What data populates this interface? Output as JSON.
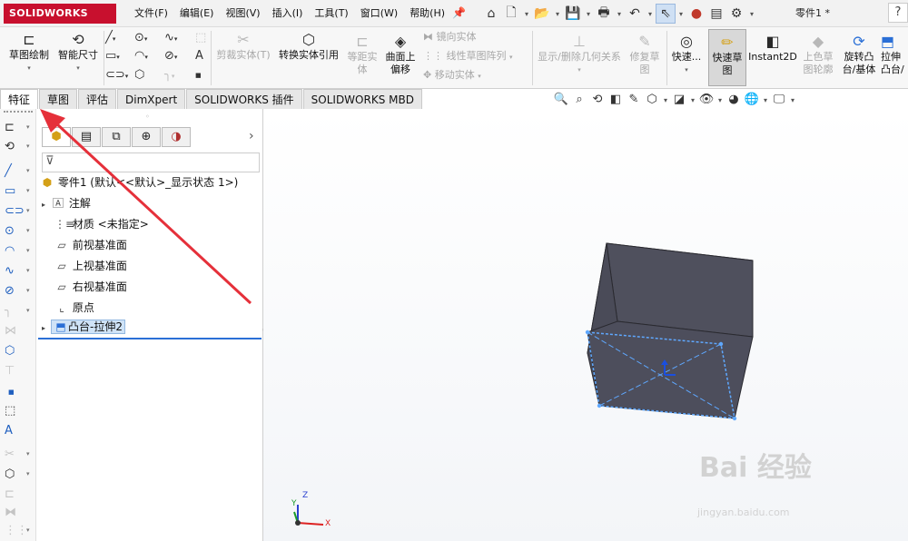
{
  "app": {
    "logo": "SOLIDWORKS",
    "doc_title": "零件1 *"
  },
  "menu": [
    "文件(F)",
    "编辑(E)",
    "视图(V)",
    "插入(I)",
    "工具(T)",
    "窗口(W)",
    "帮助(H)"
  ],
  "quick_access": [
    "home-icon",
    "new-doc-icon",
    "open-icon",
    "save-icon",
    "print-icon",
    "undo-icon",
    "select-icon",
    "rebuild-icon",
    "file-props-icon",
    "options-icon"
  ],
  "ribbon": {
    "sketch": "草图绘制",
    "smart_dim": "智能尺寸",
    "trim": "剪裁实体(T)",
    "convert": "转换实体引用",
    "offset": "等距实体",
    "surface_offset": "曲面上偏移",
    "mirror": "镜向实体",
    "linear_pattern": "线性草图阵列",
    "move": "移动实体",
    "relations": "显示/删除几何关系",
    "repair": "修复草图",
    "quick_snaps": "快速...",
    "rapid_sketch": "快速草图",
    "instant2d": "Instant2D",
    "shaded_contours": "上色草图轮廓",
    "revolve": "旋转凸台/基体",
    "extrude": "拉伸凸台/基体"
  },
  "tabs": [
    "特征",
    "草图",
    "评估",
    "DimXpert",
    "SOLIDWORKS 插件",
    "SOLIDWORKS MBD"
  ],
  "active_tab": "特征",
  "tree": {
    "root": "零件1 (默认<<默认>_显示状态 1>)",
    "items": [
      "注解",
      "材质 <未指定>",
      "前视基准面",
      "上视基准面",
      "右视基准面",
      "原点",
      "凸台-拉伸2"
    ]
  },
  "triad": {
    "x": "X",
    "y": "Y",
    "z": "Z"
  },
  "watermark": {
    "text": "Bai 经验",
    "url": "jingyan.baidu.com"
  },
  "colors": {
    "brand": "#c8102e",
    "accent": "#2a6fd6",
    "annotation_arrow": "#e5303a",
    "model": "#4d4e5c"
  }
}
